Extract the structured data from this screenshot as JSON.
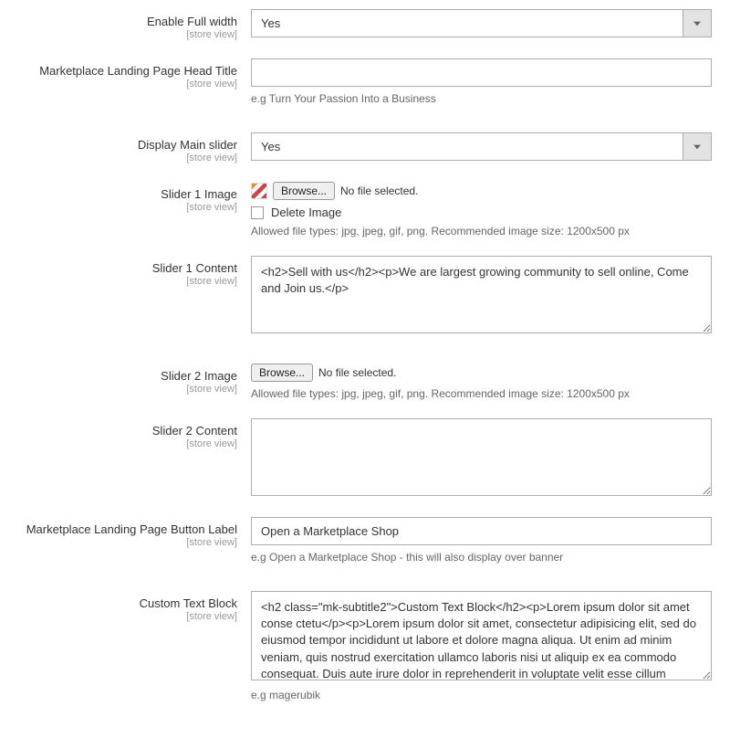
{
  "scope": "[store view]",
  "fields": {
    "enable_full_width": {
      "label": "Enable Full width",
      "value": "Yes"
    },
    "landing_head_title": {
      "label": "Marketplace Landing Page Head Title",
      "value": "",
      "hint": "e.g Turn Your Passion Into a Business"
    },
    "display_main_slider": {
      "label": "Display Main slider",
      "value": "Yes"
    },
    "slider1_image": {
      "label": "Slider 1 Image",
      "browse": "Browse...",
      "no_file": "No file selected.",
      "delete_label": "Delete Image",
      "hint": "Allowed file types: jpg, jpeg, gif, png. Recommended image size: 1200x500 px"
    },
    "slider1_content": {
      "label": "Slider 1 Content",
      "value": "<h2>Sell with us</h2><p>We are largest growing community to sell online, Come and Join us.</p>"
    },
    "slider2_image": {
      "label": "Slider 2 Image",
      "browse": "Browse...",
      "no_file": "No file selected.",
      "hint": "Allowed file types: jpg, jpeg, gif, png. Recommended image size: 1200x500 px"
    },
    "slider2_content": {
      "label": "Slider 2 Content",
      "value": ""
    },
    "button_label": {
      "label": "Marketplace Landing Page Button Label",
      "value": "Open a Marketplace Shop",
      "hint": "e.g Open a Marketplace Shop - this will also display over banner"
    },
    "custom_text_block": {
      "label": "Custom Text Block",
      "value": "<h2 class=\"mk-subtitle2\">Custom Text Block</h2><p>Lorem ipsum dolor sit amet conse ctetu</p><p>Lorem ipsum dolor sit amet, consectetur adipisicing elit, sed do eiusmod tempor incididunt ut labore et dolore magna aliqua. Ut enim ad minim veniam, quis nostrud exercitation ullamco laboris nisi ut aliquip ex ea commodo consequat. Duis aute irure dolor in reprehenderit in voluptate velit esse cillum dolore eu fugiat nulla pariatur.",
      "hint": "e.g magerubik"
    }
  }
}
